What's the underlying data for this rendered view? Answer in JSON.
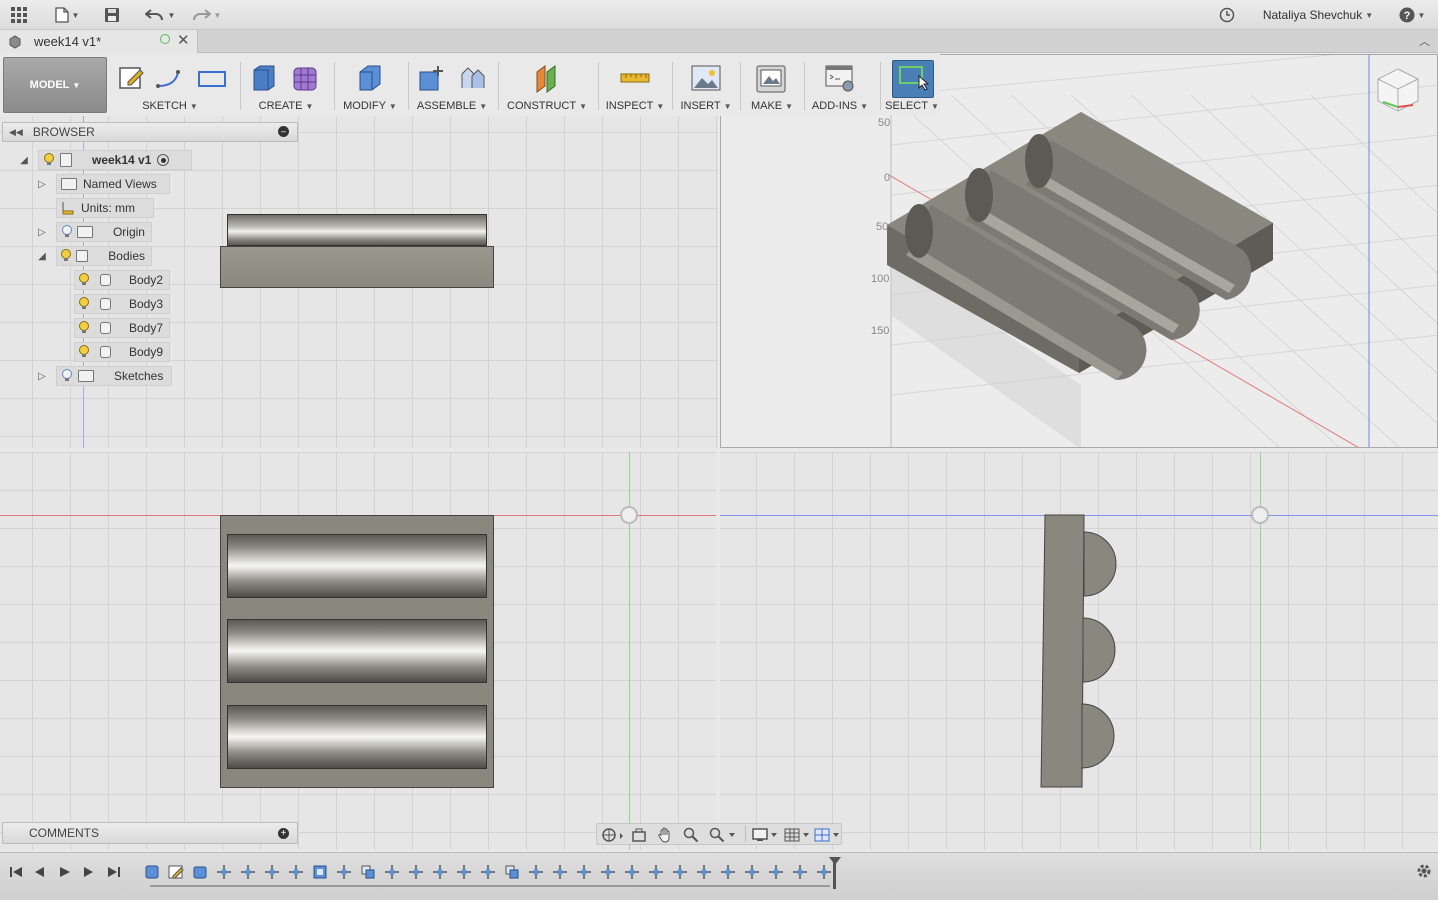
{
  "topbar": {
    "user_name": "Nataliya Shevchuk",
    "icons": [
      "apps-grid-icon",
      "file-icon",
      "save-icon",
      "undo-icon",
      "redo-icon",
      "history-clock-icon",
      "help-icon"
    ]
  },
  "document_tab": {
    "title": "week14 v1*"
  },
  "toolbar": {
    "workspace": "MODEL",
    "groups": [
      {
        "label": "SKETCH"
      },
      {
        "label": "CREATE"
      },
      {
        "label": "MODIFY"
      },
      {
        "label": "ASSEMBLE"
      },
      {
        "label": "CONSTRUCT"
      },
      {
        "label": "INSPECT"
      },
      {
        "label": "INSERT"
      },
      {
        "label": "MAKE"
      },
      {
        "label": "ADD-INS"
      },
      {
        "label": "SELECT"
      }
    ]
  },
  "browser": {
    "title": "BROWSER",
    "root": "week14 v1",
    "items": {
      "named_views": "Named Views",
      "units": "Units: mm",
      "origin": "Origin",
      "bodies": "Bodies",
      "body2": "Body2",
      "body3": "Body3",
      "body7": "Body7",
      "body9": "Body9",
      "sketches": "Sketches"
    }
  },
  "viewport3d": {
    "ruler_ticks": [
      "50",
      "0",
      "50",
      "100",
      "150"
    ]
  },
  "comments": {
    "title": "COMMENTS"
  },
  "colors": {
    "accent_select": "#4a7fb5",
    "body_gray": "#8a877f",
    "axis_red": "#e25050",
    "axis_green": "#5cc85c",
    "axis_blue": "#4a6fe0"
  }
}
